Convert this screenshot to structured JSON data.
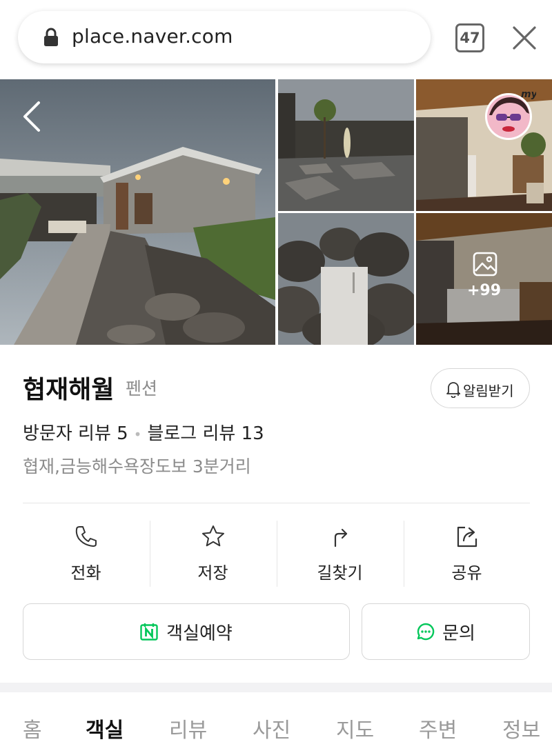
{
  "browser": {
    "url": "place.naver.com",
    "tab_count": "47"
  },
  "gallery": {
    "more_count": "+99",
    "avatar_badge": "my"
  },
  "place": {
    "name": "협재해월",
    "category": "펜션",
    "alarm_label": "알림받기",
    "visitor_reviews": "방문자 리뷰 5",
    "blog_reviews": "블로그 리뷰 13",
    "description": "협재,금능해수욕장도보 3분거리"
  },
  "actions": [
    {
      "label": "전화",
      "icon": "phone-icon"
    },
    {
      "label": "저장",
      "icon": "star-icon"
    },
    {
      "label": "길찾기",
      "icon": "directions-icon"
    },
    {
      "label": "공유",
      "icon": "share-icon"
    }
  ],
  "buttons": {
    "reserve_label": "객실예약",
    "inquiry_label": "문의"
  },
  "tabs": [
    {
      "label": "홈",
      "active": false
    },
    {
      "label": "객실",
      "active": true
    },
    {
      "label": "리뷰",
      "active": false
    },
    {
      "label": "사진",
      "active": false
    },
    {
      "label": "지도",
      "active": false
    },
    {
      "label": "주변",
      "active": false
    },
    {
      "label": "정보",
      "active": false
    }
  ],
  "colors": {
    "naver_green": "#03c75a",
    "text_primary": "#111111",
    "text_secondary": "#8b8b8b",
    "border": "#d6d6d6"
  }
}
